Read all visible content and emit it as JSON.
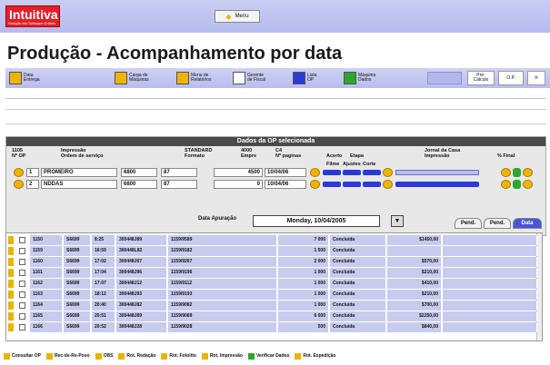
{
  "brand": {
    "name": "Intuitiva",
    "tagline": "Solução em Software Gráfico"
  },
  "menu": {
    "label": "Menu"
  },
  "page_title": "Produção - Acompanhamento por data",
  "toolbar": {
    "buttons": [
      {
        "label": "Data\nEntrega",
        "icon": "truck-icon"
      },
      {
        "label": "Carga de\nMáquinas",
        "icon": "factory-icon"
      },
      {
        "label": "Menu de\nRelatórios",
        "icon": "reports-icon"
      },
      {
        "label": "Gerente\nde Fiscal",
        "icon": "document-icon"
      },
      {
        "label": "Lista\nOP",
        "icon": "list-icon"
      },
      {
        "label": "Máquina\nDados",
        "icon": "check-icon"
      }
    ],
    "right_buttons": [
      "Pré-\nCálculo",
      "O.P.",
      "⟳"
    ]
  },
  "op_section": {
    "title": "Dados da OP selecionada",
    "headers": [
      "1105\nNº OP",
      "Impressão\nOrdem de serviço",
      "STANDARD\nFormato",
      "4000\nEmpre",
      "C4\nNº paginas",
      "Acerto",
      "Etapa",
      "Jornal da Casa\nImpressão",
      "% Final"
    ],
    "sub_headers": [
      "Filme",
      "Ajustes",
      "Corte"
    ],
    "rows": [
      {
        "seq": "1",
        "name": "PROMEIRO",
        "f1": "6800",
        "f2": "87",
        "qty": "4500",
        "date": "10/04/06"
      },
      {
        "seq": "2",
        "name": "NDDAS",
        "f1": "6800",
        "f2": "87",
        "qty": "0",
        "date": "10/04/06"
      }
    ]
  },
  "filter": {
    "label": "Data Apuração",
    "date_value": "Monday, 10/04/2005",
    "tabs": [
      "Pend.",
      "Pend.",
      "Data"
    ]
  },
  "list": {
    "rows": [
      {
        "id": "1150",
        "code": "S6699",
        "time": "8:25",
        "doc": "300448J89",
        "client": "1159/9589",
        "qty": "7 000",
        "status": "Concluída",
        "value": "$1450,00"
      },
      {
        "id": "1159",
        "code": "S6699",
        "time": "16:59",
        "doc": "300448L82",
        "client": "1159/9182",
        "qty": "1 500",
        "status": "Concluída",
        "value": ""
      },
      {
        "id": "1160",
        "code": "S6699",
        "time": "17:02",
        "doc": "300448J67",
        "client": "1159/9267",
        "qty": "2 000",
        "status": "Concluída",
        "value": "$570,00"
      },
      {
        "id": "1161",
        "code": "S6699",
        "time": "17:04",
        "doc": "300448J96",
        "client": "1159/9196",
        "qty": "1 000",
        "status": "Concluída",
        "value": "$210,00"
      },
      {
        "id": "1162",
        "code": "S6699",
        "time": "17:07",
        "doc": "300448J12",
        "client": "1159/9112",
        "qty": "1 000",
        "status": "Concluída",
        "value": "$410,00"
      },
      {
        "id": "1163",
        "code": "S6699",
        "time": "18:12",
        "doc": "300448J93",
        "client": "1159/9193",
        "qty": "1 000",
        "status": "Concluída",
        "value": "$210,00"
      },
      {
        "id": "1164",
        "code": "S6699",
        "time": "20:40",
        "doc": "300448J82",
        "client": "1159/9082",
        "qty": "1 000",
        "status": "Concluída",
        "value": "$700,00"
      },
      {
        "id": "1165",
        "code": "S6699",
        "time": "20:51",
        "doc": "300448J89",
        "client": "1159/9089",
        "qty": "6 000",
        "status": "Concluída",
        "value": "$2250,00"
      },
      {
        "id": "1166",
        "code": "S6699",
        "time": "20:52",
        "doc": "300448J28",
        "client": "1159/9028",
        "qty": "500",
        "status": "Concluída",
        "value": "$840,00"
      }
    ]
  },
  "legend": [
    {
      "label": "Consultar OP",
      "color": "#e8b400"
    },
    {
      "label": "Rec-de-Re-Poso",
      "color": "#e8b400"
    },
    {
      "label": "OBS",
      "color": "#e8b400"
    },
    {
      "label": "Rot. Redação",
      "color": "#e8b400"
    },
    {
      "label": "Rot. Fotolito",
      "color": "#e8b400"
    },
    {
      "label": "Rot. Impressão",
      "color": "#e8b400"
    },
    {
      "label": "Verificar Dados",
      "color": "#2ea52e"
    },
    {
      "label": "Rot. Expedição",
      "color": "#e8b400"
    }
  ]
}
